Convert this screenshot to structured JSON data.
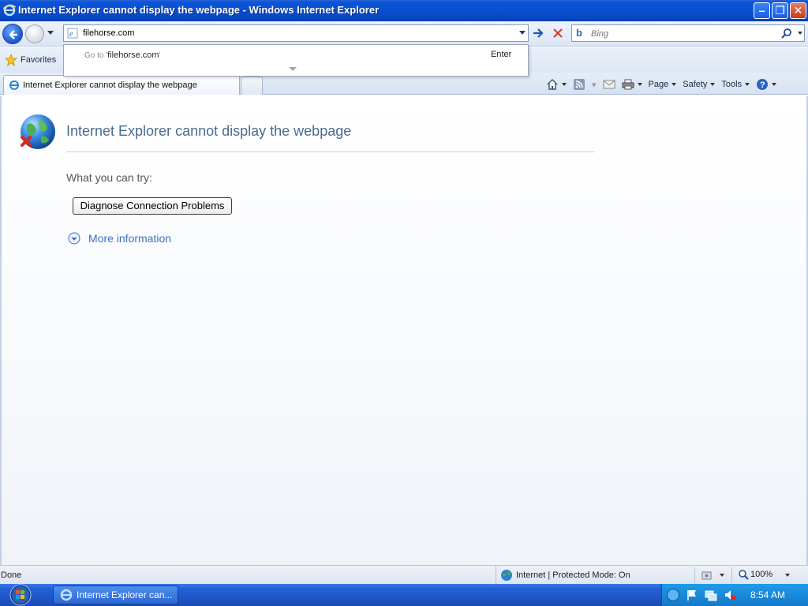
{
  "window": {
    "title": "Internet Explorer cannot display the webpage - Windows Internet Explorer"
  },
  "address": {
    "value": "filehorse.com"
  },
  "search": {
    "placeholder": "Bing"
  },
  "suggest": {
    "go_to_prefix": "Go to '",
    "url": "filehorse.com",
    "go_to_suffix": "'",
    "enter_label": "Enter"
  },
  "favorites": {
    "label": "Favorites"
  },
  "tab": {
    "label": "Internet Explorer cannot display the webpage"
  },
  "command_bar": {
    "page": "Page",
    "safety": "Safety",
    "tools": "Tools"
  },
  "content": {
    "title": "Internet Explorer cannot display the webpage",
    "try_label": "What you can try:",
    "diagnose_button": "Diagnose Connection Problems",
    "more_info": "More information"
  },
  "status": {
    "left": "Done",
    "zone": "Internet | Protected Mode: On",
    "zoom": "100%"
  },
  "taskbar": {
    "item_label": "Internet Explorer can...",
    "clock": "8:54 AM"
  },
  "colors": {
    "title_bar": "#0a4fd0",
    "link": "#3b6fc2",
    "error_title": "#4a6a8f"
  }
}
